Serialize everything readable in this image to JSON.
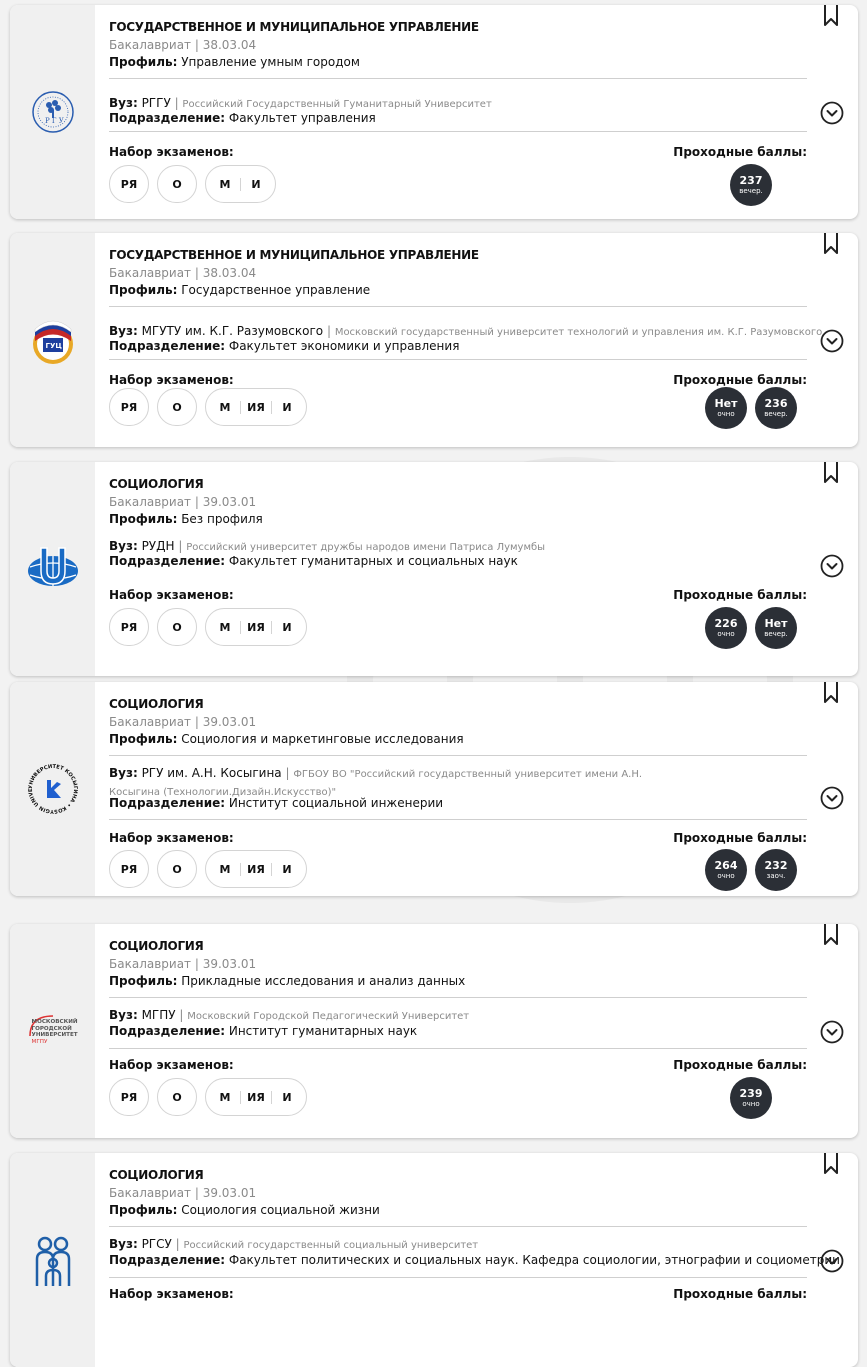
{
  "cards": [
    {
      "title": "ГОСУДАРСТВЕННОЕ И МУНИЦИПАЛЬНОЕ УПРАВЛЕНИЕ",
      "level": "Бакалавриат | 38.03.04",
      "profile_label": "Профиль:",
      "profile": "Управление умным городом",
      "vuz_label": "Вуз:",
      "vuz_short": "РГГУ",
      "vuz_full": "Российский Государственный Гуманитарный Университет",
      "dept_label": "Подразделение:",
      "dept": "Факультет управления",
      "exams_label": "Набор экзаменов:",
      "scores_label": "Проходные баллы:",
      "exam_single": [
        "РЯ",
        "О"
      ],
      "exam_group": [
        "М",
        "И"
      ],
      "scores": [
        {
          "value": "237",
          "mode": "вечер."
        }
      ],
      "logo": "rggu-logo"
    },
    {
      "title": "ГОСУДАРСТВЕННОЕ И МУНИЦИПАЛЬНОЕ УПРАВЛЕНИЕ",
      "level": "Бакалавриат | 38.03.04",
      "profile_label": "Профиль:",
      "profile": "Государственное управление",
      "vuz_label": "Вуз:",
      "vuz_short": "МГУТУ им. К.Г. Разумовского",
      "vuz_full": "Московский государственный университет технологий и управления им. К.Г. Разумовского",
      "dept_label": "Подразделение:",
      "dept": "Факультет экономики и управления",
      "exams_label": "Набор экзаменов:",
      "scores_label": "Проходные баллы:",
      "exam_single": [
        "РЯ",
        "О"
      ],
      "exam_group": [
        "М",
        "ИЯ",
        "И"
      ],
      "scores": [
        {
          "value": "Нет",
          "mode": "очно"
        },
        {
          "value": "236",
          "mode": "вечер."
        }
      ],
      "logo": "mgutu-logo"
    },
    {
      "title": "СОЦИОЛОГИЯ",
      "level": "Бакалавриат | 39.03.01",
      "profile_label": "Профиль:",
      "profile": "Без профиля",
      "vuz_label": "Вуз:",
      "vuz_short": "РУДН",
      "vuz_full": "Российский университет дружбы народов имени Патриса Лумумбы",
      "dept_label": "Подразделение:",
      "dept": "Факультет гуманитарных и социальных наук",
      "exams_label": "Набор экзаменов:",
      "scores_label": "Проходные баллы:",
      "exam_single": [
        "РЯ",
        "О"
      ],
      "exam_group": [
        "М",
        "ИЯ",
        "И"
      ],
      "scores": [
        {
          "value": "226",
          "mode": "очно"
        },
        {
          "value": "Нет",
          "mode": "вечер."
        }
      ],
      "logo": "rudn-logo"
    },
    {
      "title": "СОЦИОЛОГИЯ",
      "level": "Бакалавриат | 39.03.01",
      "profile_label": "Профиль:",
      "profile": "Социология и маркетинговые исследования",
      "vuz_label": "Вуз:",
      "vuz_short": "РГУ им. А.Н. Косыгина",
      "vuz_full": "ФГБОУ ВО \"Российский государственный университет имени А.Н. Косыгина (Технологии.Дизайн.Искусство)\"",
      "dept_label": "Подразделение:",
      "dept": "Институт социальной инженерии",
      "exams_label": "Набор экзаменов:",
      "scores_label": "Проходные баллы:",
      "exam_single": [
        "РЯ",
        "О"
      ],
      "exam_group": [
        "М",
        "ИЯ",
        "И"
      ],
      "scores": [
        {
          "value": "264",
          "mode": "очно"
        },
        {
          "value": "232",
          "mode": "заоч."
        }
      ],
      "logo": "kosygin-logo"
    },
    {
      "title": "СОЦИОЛОГИЯ",
      "level": "Бакалавриат | 39.03.01",
      "profile_label": "Профиль:",
      "profile": "Прикладные исследования и анализ данных",
      "vuz_label": "Вуз:",
      "vuz_short": "МГПУ",
      "vuz_full": "Московский Городской Педагогический Университет",
      "dept_label": "Подразделение:",
      "dept": "Институт гуманитарных наук",
      "exams_label": "Набор экзаменов:",
      "scores_label": "Проходные баллы:",
      "exam_single": [
        "РЯ",
        "О"
      ],
      "exam_group": [
        "М",
        "ИЯ",
        "И"
      ],
      "scores": [
        {
          "value": "239",
          "mode": "очно"
        }
      ],
      "logo": "mgpu-logo",
      "logo_text": [
        "МОСКОВСКИЙ",
        "ГОРОДСКОЙ",
        "УНИВЕРСИТЕТ",
        "МГПУ"
      ]
    },
    {
      "title": "СОЦИОЛОГИЯ",
      "level": "Бакалавриат | 39.03.01",
      "profile_label": "Профиль:",
      "profile": "Социология социальной жизни",
      "vuz_label": "Вуз:",
      "vuz_short": "РГСУ",
      "vuz_full": "Российский государственный социальный университет",
      "dept_label": "Подразделение:",
      "dept": "Факультет политических и социальных наук. Кафедра социологии, этнографии и социометрии",
      "exams_label": "Набор экзаменов:",
      "scores_label": "Проходные баллы:",
      "exam_single": [],
      "exam_group": [],
      "scores": [],
      "logo": "rgsu-logo"
    }
  ]
}
